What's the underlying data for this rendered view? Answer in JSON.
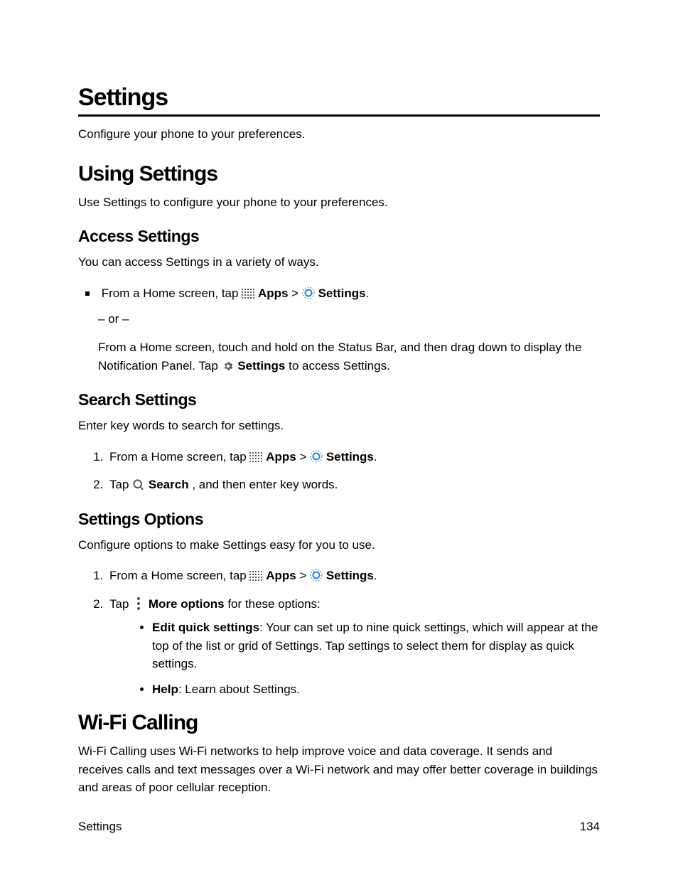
{
  "page": {
    "title": "Settings",
    "intro": "Configure your phone to your preferences."
  },
  "using": {
    "heading": "Using Settings",
    "intro": "Use Settings to configure your phone to your preferences."
  },
  "access": {
    "heading": "Access Settings",
    "intro": "You can access Settings in a variety of ways.",
    "step1_pre": "From a Home screen, tap ",
    "apps_label": "Apps",
    "gt": " > ",
    "settings_label": " Settings",
    "period": ".",
    "or": "– or –",
    "cont_a": "From a Home screen, touch and hold on the Status Bar, and then drag down to display the Notification Panel. Tap ",
    "cont_settings": "Settings",
    "cont_b": " to access Settings."
  },
  "search": {
    "heading": "Search Settings",
    "intro": "Enter key words to search for settings.",
    "step1_pre": "From a Home screen, tap ",
    "apps_label": "Apps",
    "gt": " > ",
    "settings_label": " Settings",
    "period": ".",
    "step2_pre": "Tap ",
    "search_label": "Search",
    "step2_post": ", and then enter key words."
  },
  "options": {
    "heading": "Settings Options",
    "intro": "Configure options to make Settings easy for you to use.",
    "step1_pre": "From a Home screen, tap ",
    "apps_label": "Apps",
    "gt": " > ",
    "settings_label": " Settings",
    "period": ".",
    "step2_pre": "Tap ",
    "more_label": "More options",
    "step2_post": " for these options:",
    "bullet_edit_label": "Edit quick settings",
    "bullet_edit_text": ": Your can set up to nine quick settings, which will appear at the top of the list or grid of Settings. Tap settings to select them for display as quick settings.",
    "bullet_help_label": "Help",
    "bullet_help_text": ": Learn about Settings."
  },
  "wifi": {
    "heading": "Wi-Fi Calling",
    "intro": "Wi-Fi Calling uses Wi-Fi networks to help improve voice and data coverage. It sends and receives calls and text messages over a Wi-Fi network and may offer better coverage in buildings and areas of poor cellular reception."
  },
  "footer": {
    "left": "Settings",
    "right": "134"
  }
}
